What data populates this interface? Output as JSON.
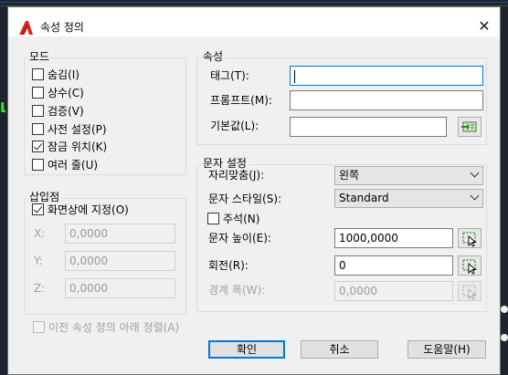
{
  "dialog": {
    "title": "속성 정의",
    "close_glyph": "✕"
  },
  "mode": {
    "title": "모드",
    "items": [
      {
        "label": "숨김(I)",
        "checked": false
      },
      {
        "label": "상수(C)",
        "checked": false
      },
      {
        "label": "검증(V)",
        "checked": false
      },
      {
        "label": "사전 설정(P)",
        "checked": false
      },
      {
        "label": "잠금 위치(K)",
        "checked": true
      },
      {
        "label": "여러 줄(U)",
        "checked": false
      }
    ]
  },
  "attribute": {
    "title": "속성",
    "tag_label": "태그(T):",
    "tag_value": "",
    "prompt_label": "프롬프트(M):",
    "prompt_value": "",
    "default_label": "기본값(L):",
    "default_value": ""
  },
  "insertion": {
    "title": "삽입점",
    "specify_on_screen": "화면상에 지정(O)",
    "specify_checked": true,
    "x_label": "X:",
    "x_value": "0,0000",
    "y_label": "Y:",
    "y_value": "0,0000",
    "z_label": "Z:",
    "z_value": "0,0000"
  },
  "text_settings": {
    "title": "문자 설정",
    "justification_label": "자리맞춤(J):",
    "justification_value": "왼쪽",
    "style_label": "문자 스타일(S):",
    "style_value": "Standard",
    "annotative_label": "주석(N)",
    "annotative_checked": false,
    "height_label": "문자 높이(E):",
    "height_value": "1000,0000",
    "rotation_label": "회전(R):",
    "rotation_value": "0",
    "boundary_label": "경계 폭(W):",
    "boundary_value": "0,0000"
  },
  "align_below": {
    "label": "이전 속성 정의 아래 정렬(A)",
    "checked": false
  },
  "buttons": {
    "ok": "확인",
    "cancel": "취소",
    "help": "도움말(H)"
  },
  "colors": {
    "accent": "#0078d7",
    "app_icon": "#e2231a",
    "background_drawing": "#1f2330"
  },
  "icons": [
    "autocad-logo-icon",
    "close-icon",
    "insert-field-icon",
    "pick-on-screen-icon",
    "chevron-down-icon",
    "checkbox-icon"
  ]
}
